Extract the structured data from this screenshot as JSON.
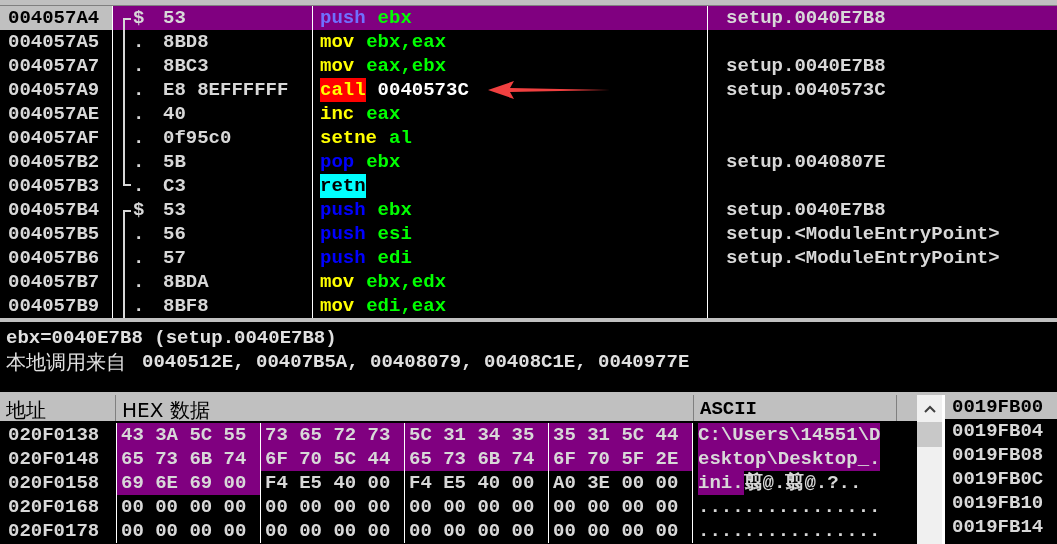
{
  "disassembly": {
    "rows": [
      {
        "address": "004057A4",
        "kind": "start",
        "marker": "$",
        "hex": "53",
        "mnemonic": {
          "text": "push",
          "kind": "stack"
        },
        "operands": [
          {
            "text": "ebx",
            "kind": "register"
          }
        ],
        "comment": "setup.0040E7B8",
        "selected": true
      },
      {
        "address": "004057A5",
        "kind": "inside",
        "marker": ".",
        "hex": "8BD8",
        "mnemonic": {
          "text": "mov",
          "kind": "plain"
        },
        "operands": [
          {
            "text": "ebx,eax",
            "kind": "register"
          }
        ],
        "selected": false
      },
      {
        "address": "004057A7",
        "kind": "inside",
        "marker": ".",
        "hex": "8BC3",
        "mnemonic": {
          "text": "mov",
          "kind": "plain"
        },
        "operands": [
          {
            "text": "eax,ebx",
            "kind": "register"
          }
        ],
        "comment": "setup.0040E7B8",
        "selected": false
      },
      {
        "address": "004057A9",
        "kind": "inside",
        "marker": ".",
        "hex": "E8 8EFFFFFF",
        "mnemonic": {
          "text": "call",
          "kind": "call"
        },
        "operands": [
          {
            "text": "0040573C",
            "kind": "address"
          }
        ],
        "comment": "setup.0040573C",
        "selected": false,
        "annotated": true
      },
      {
        "address": "004057AE",
        "kind": "inside",
        "marker": ".",
        "hex": "40",
        "mnemonic": {
          "text": "inc",
          "kind": "plain"
        },
        "operands": [
          {
            "text": "eax",
            "kind": "register"
          }
        ],
        "selected": false
      },
      {
        "address": "004057AF",
        "kind": "inside",
        "marker": ".",
        "hex": "0f95c0",
        "mnemonic": {
          "text": "setne",
          "kind": "plain"
        },
        "operands": [
          {
            "text": "al",
            "kind": "register"
          }
        ],
        "selected": false
      },
      {
        "address": "004057B2",
        "kind": "inside",
        "marker": ".",
        "hex": "5B",
        "mnemonic": {
          "text": "pop",
          "kind": "stack"
        },
        "operands": [
          {
            "text": "ebx",
            "kind": "register"
          }
        ],
        "comment": "setup.0040807E",
        "selected": false
      },
      {
        "address": "004057B3",
        "kind": "end",
        "marker": ".",
        "hex": "C3",
        "mnemonic": {
          "text": "retn",
          "kind": "return"
        },
        "operands": [],
        "selected": false
      },
      {
        "address": "004057B4",
        "kind": "start",
        "marker": "$",
        "hex": "53",
        "mnemonic": {
          "text": "push",
          "kind": "stack"
        },
        "operands": [
          {
            "text": "ebx",
            "kind": "register"
          }
        ],
        "comment": "setup.0040E7B8",
        "selected": false
      },
      {
        "address": "004057B5",
        "kind": "inside",
        "marker": ".",
        "hex": "56",
        "mnemonic": {
          "text": "push",
          "kind": "stack"
        },
        "operands": [
          {
            "text": "esi",
            "kind": "register"
          }
        ],
        "comment": "setup.<ModuleEntryPoint>",
        "selected": false
      },
      {
        "address": "004057B6",
        "kind": "inside",
        "marker": ".",
        "hex": "57",
        "mnemonic": {
          "text": "push",
          "kind": "stack"
        },
        "operands": [
          {
            "text": "edi",
            "kind": "register"
          }
        ],
        "comment": "setup.<ModuleEntryPoint>",
        "selected": false
      },
      {
        "address": "004057B7",
        "kind": "inside",
        "marker": ".",
        "hex": "8BDA",
        "mnemonic": {
          "text": "mov",
          "kind": "plain"
        },
        "operands": [
          {
            "text": "ebx,edx",
            "kind": "register"
          }
        ],
        "selected": false
      },
      {
        "address": "004057B9",
        "kind": "inside",
        "marker": ".",
        "hex": "8BF8",
        "mnemonic": {
          "text": "mov",
          "kind": "plain"
        },
        "operands": [
          {
            "text": "edi,eax",
            "kind": "register"
          }
        ],
        "selected": false
      }
    ]
  },
  "info": {
    "line_1": "ebx=0040E7B8 (setup.0040E7B8)",
    "line_2_label": "本地调用来自",
    "line_2_value": "0040512E, 00407B5A, 00408079, 00408C1E, 0040977E"
  },
  "dump": {
    "columns": [
      "地址",
      "HEX 数据",
      "ASCII"
    ],
    "rows": [
      {
        "address": "020F0138",
        "groups": [
          {
            "bytes": "43 3A 5C 55",
            "selected": true
          },
          {
            "bytes": "73 65 72 73",
            "selected": true
          },
          {
            "bytes": "5C 31 34 35",
            "selected": true
          },
          {
            "bytes": "35 31 5C 44",
            "selected": true
          }
        ],
        "ascii": [
          {
            "text": "C:\\Users\\14551\\D",
            "selected": true
          }
        ]
      },
      {
        "address": "020F0148",
        "groups": [
          {
            "bytes": "65 73 6B 74",
            "selected": true
          },
          {
            "bytes": "6F 70 5C 44",
            "selected": true
          },
          {
            "bytes": "65 73 6B 74",
            "selected": true
          },
          {
            "bytes": "6F 70 5F 2E",
            "selected": true
          }
        ],
        "ascii": [
          {
            "text": "esktop\\Desktop_.",
            "selected": true
          }
        ]
      },
      {
        "address": "020F0158",
        "groups": [
          {
            "bytes": "69 6E 69 00",
            "selected": true
          },
          {
            "bytes": "F4 E5 40 00",
            "selected": false
          },
          {
            "bytes": "F4 E5 40 00",
            "selected": false
          },
          {
            "bytes": "A0 3E 00 00",
            "selected": false
          }
        ],
        "ascii": [
          {
            "text": "ini.",
            "selected": true
          },
          {
            "text": "翦@.翦@.?..",
            "selected": false
          }
        ]
      },
      {
        "address": "020F0168",
        "groups": [
          {
            "bytes": "00 00 00 00",
            "selected": false
          },
          {
            "bytes": "00 00 00 00",
            "selected": false
          },
          {
            "bytes": "00 00 00 00",
            "selected": false
          },
          {
            "bytes": "00 00 00 00",
            "selected": false
          }
        ],
        "ascii": [
          {
            "text": "................",
            "selected": false
          }
        ]
      },
      {
        "address": "020F0178",
        "groups": [
          {
            "bytes": "00 00 00 00",
            "selected": false
          },
          {
            "bytes": "00 00 00 00",
            "selected": false
          },
          {
            "bytes": "00 00 00 00",
            "selected": false
          },
          {
            "bytes": "00 00 00 00",
            "selected": false
          }
        ],
        "ascii": [
          {
            "text": "................",
            "selected": false
          }
        ]
      }
    ]
  },
  "stack": {
    "rows": [
      {
        "address": "0019FB00",
        "selected": true
      },
      {
        "address": "0019FB04",
        "selected": false
      },
      {
        "address": "0019FB08",
        "selected": false
      },
      {
        "address": "0019FB0C",
        "selected": false
      },
      {
        "address": "0019FB10",
        "selected": false
      },
      {
        "address": "0019FB14",
        "selected": false
      }
    ]
  }
}
